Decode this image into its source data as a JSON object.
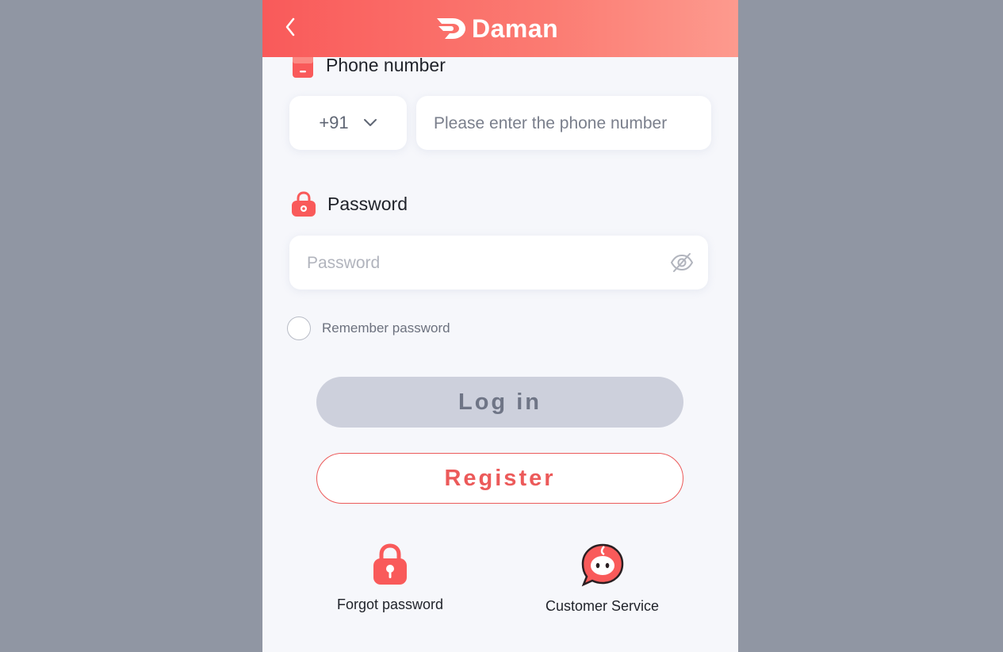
{
  "header": {
    "brand": "Daman",
    "back_icon": "chevron-left-icon"
  },
  "phone": {
    "label": "Phone number",
    "country_code": "+91",
    "placeholder": "Please enter the phone number"
  },
  "password": {
    "label": "Password",
    "placeholder": "Password"
  },
  "remember": {
    "label": "Remember password"
  },
  "buttons": {
    "login": "Log in",
    "register": "Register"
  },
  "footer": {
    "forgot": "Forgot password",
    "service": "Customer Service"
  },
  "colors": {
    "accent": "#f95a5a",
    "header_gradient_end": "#fd9a8e",
    "login_disabled": "#cdd0dc",
    "background": "#f6f7fb"
  }
}
